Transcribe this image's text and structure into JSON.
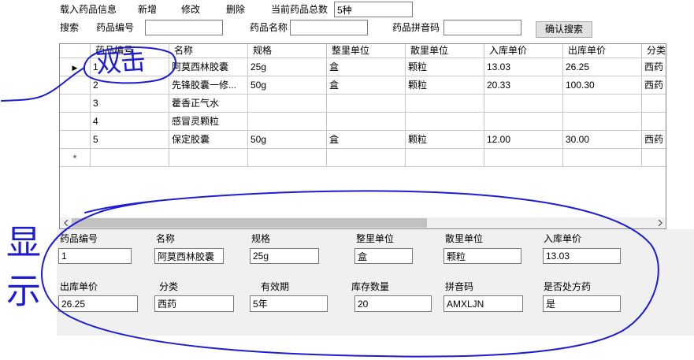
{
  "menu": {
    "load": "载入药品信息",
    "add": "新增",
    "edit": "修改",
    "delete": "删除"
  },
  "summary": {
    "label": "当前药品总数",
    "value": "5种"
  },
  "search": {
    "label": "搜索",
    "id_label": "药品编号",
    "id_value": "",
    "name_label": "药品名称",
    "name_value": "",
    "pinyin_label": "药品拼音码",
    "pinyin_value": "",
    "button": "确认搜索"
  },
  "grid": {
    "columns": [
      "药品编号",
      "名称",
      "规格",
      "整里单位",
      "散里单位",
      "入库单价",
      "出库单价",
      "分类"
    ],
    "rows": [
      [
        "1",
        "阿莫西林胶囊",
        "25g",
        "盒",
        "颗粒",
        "13.03",
        "26.25",
        "西药"
      ],
      [
        "2",
        "先锋胶囊一修...",
        "50g",
        "盒",
        "颗粒",
        "20.33",
        "100.30",
        "西药"
      ],
      [
        "3",
        "藿香正气水",
        "",
        "",
        "",
        "",
        "",
        ""
      ],
      [
        "4",
        "感冒灵颗粒",
        "",
        "",
        "",
        "",
        "",
        ""
      ],
      [
        "5",
        "保定胶囊",
        "50g",
        "盒",
        "颗粒",
        "12.00",
        "30.00",
        "西药"
      ]
    ],
    "current_row_index": 0,
    "current_row_marker": "▶",
    "new_row_marker": "*",
    "horizontal_scroll": {
      "position": 0,
      "visible_fraction": 0.61
    }
  },
  "detail": {
    "fields": [
      {
        "label": "药品编号",
        "value": "1"
      },
      {
        "label": "名称",
        "value": "阿莫西林胶囊"
      },
      {
        "label": "规格",
        "value": "25g"
      },
      {
        "label": "整里单位",
        "value": "盒"
      },
      {
        "label": "散里单位",
        "value": "颗粒"
      },
      {
        "label": "入库单价",
        "value": "13.03"
      },
      {
        "label": "出库单价",
        "value": "26.25"
      },
      {
        "label": "分类",
        "value": "西药"
      },
      {
        "label": "有效期",
        "value": "5年"
      },
      {
        "label": "库存数量",
        "value": "20"
      },
      {
        "label": "拼音码",
        "value": "AMXLJN"
      },
      {
        "label": "是否处方药",
        "value": "是"
      }
    ]
  },
  "annotations": {
    "double_click": "双击",
    "display": "显示"
  },
  "colors": {
    "handwriting_ink": "#1c1cd2",
    "panel_background": "#f0f0f0",
    "button_background": "#e1e1e1",
    "grid_line": "#c8c8c8"
  }
}
